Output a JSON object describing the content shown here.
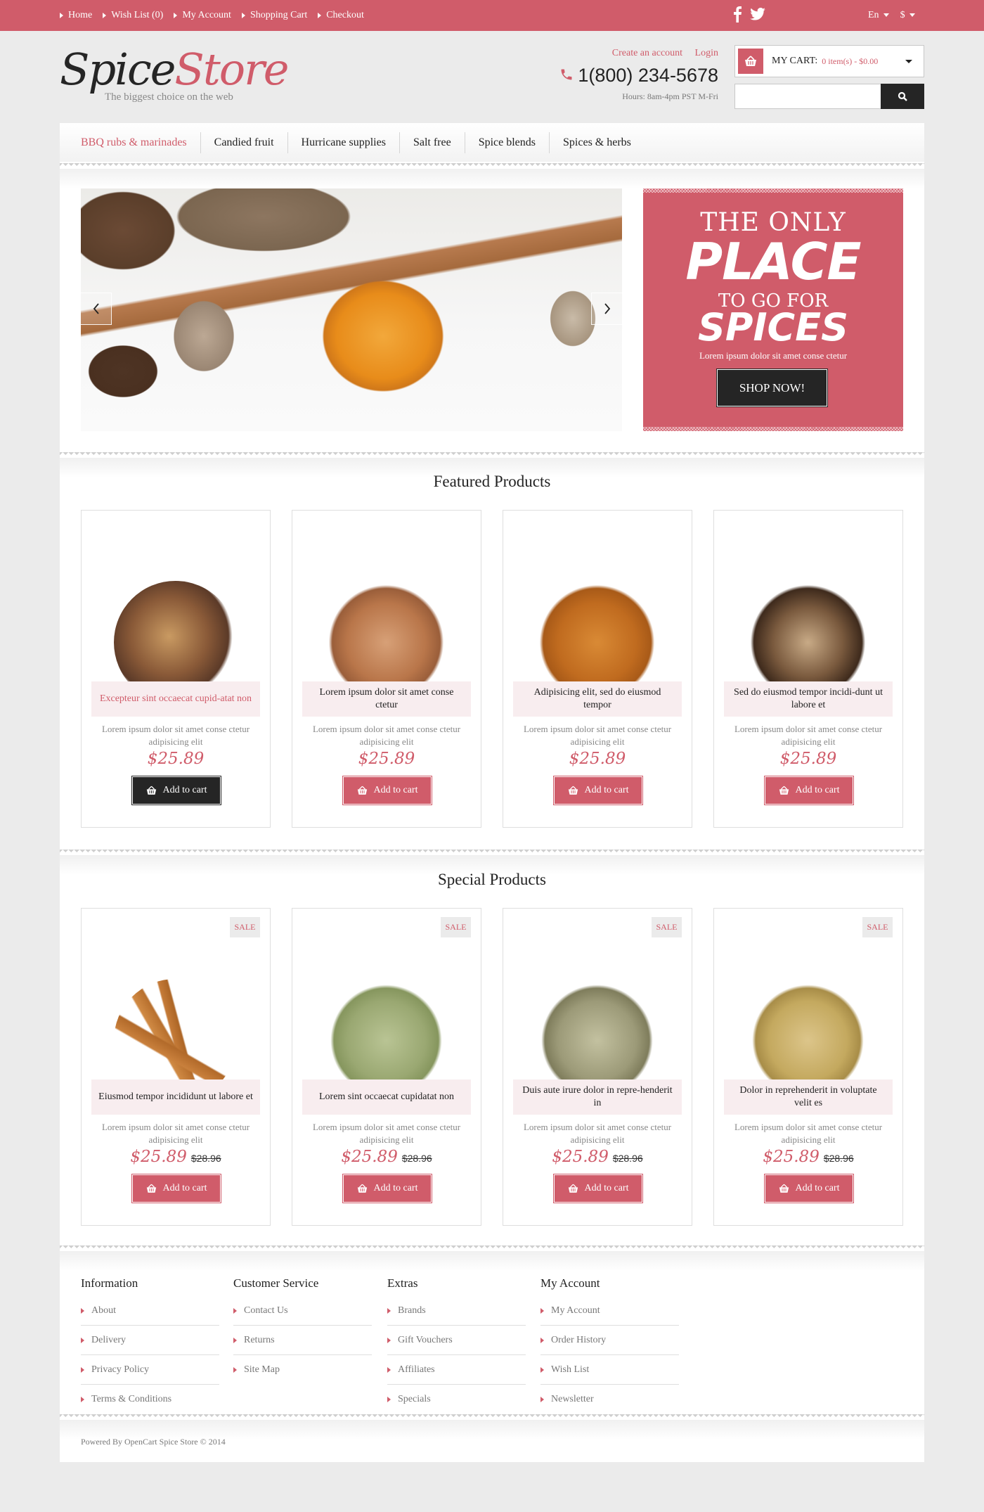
{
  "topbar": {
    "links": [
      "Home",
      "Wish List (0)",
      "My Account",
      "Shopping Cart",
      "Checkout"
    ],
    "social": [
      "facebook-icon",
      "twitter-icon"
    ],
    "language": "En",
    "currency": "$"
  },
  "header": {
    "logo_part1": "Spice",
    "logo_part2": "Store",
    "tagline": "The biggest choice on the web",
    "create_account": "Create an account",
    "login": "Login",
    "phone": "1(800) 234-5678",
    "hours": "Hours: 8am-4pm PST M-Fri",
    "cart_label": "MY CART:",
    "cart_value": "0 item(s) - $0.00",
    "search_placeholder": ""
  },
  "nav": {
    "items": [
      "BBQ rubs & marinades",
      "Candied fruit",
      "Hurricane supplies",
      "Salt free",
      "Spice blends",
      "Spices & herbs"
    ],
    "active_index": 0
  },
  "promo": {
    "line1": "THE ONLY",
    "line2": "PLACE",
    "line3": "TO GO FOR",
    "line4": "SPICES",
    "subtitle": "Lorem ipsum dolor sit amet conse ctetur",
    "button": "SHOP NOW!"
  },
  "featured": {
    "title": "Featured Products",
    "products": [
      {
        "name": "Excepteur sint occaecat cupid-atat non",
        "desc": "Lorem ipsum dolor sit amet conse ctetur adipisicing elit",
        "price": "$25.89",
        "button": "Add to cart",
        "highlight": true
      },
      {
        "name": "Lorem ipsum dolor sit amet conse ctetur",
        "desc": "Lorem ipsum dolor sit amet conse ctetur adipisicing elit",
        "price": "$25.89",
        "button": "Add to cart"
      },
      {
        "name": "Adipisicing elit, sed do eiusmod tempor",
        "desc": "Lorem ipsum dolor sit amet conse ctetur adipisicing elit",
        "price": "$25.89",
        "button": "Add to cart"
      },
      {
        "name": "Sed do eiusmod tempor incidi-dunt ut labore et",
        "desc": "Lorem ipsum dolor sit amet conse ctetur adipisicing elit",
        "price": "$25.89",
        "button": "Add to cart"
      }
    ]
  },
  "special": {
    "title": "Special Products",
    "products": [
      {
        "badge": "SALE",
        "name": "Eiusmod tempor incididunt ut labore et",
        "desc": "Lorem ipsum dolor sit amet conse ctetur adipisicing elit",
        "price": "$25.89",
        "old_price": "$28.96",
        "button": "Add to cart"
      },
      {
        "badge": "SALE",
        "name": "Lorem sint occaecat cupidatat non",
        "desc": "Lorem ipsum dolor sit amet conse ctetur adipisicing elit",
        "price": "$25.89",
        "old_price": "$28.96",
        "button": "Add to cart"
      },
      {
        "badge": "SALE",
        "name": "Duis aute irure dolor in repre-henderit in",
        "desc": "Lorem ipsum dolor sit amet conse ctetur adipisicing elit",
        "price": "$25.89",
        "old_price": "$28.96",
        "button": "Add to cart"
      },
      {
        "badge": "SALE",
        "name": "Dolor in reprehenderit in voluptate velit es",
        "desc": "Lorem ipsum dolor sit amet conse ctetur adipisicing elit",
        "price": "$25.89",
        "old_price": "$28.96",
        "button": "Add to cart"
      }
    ]
  },
  "footer": {
    "columns": [
      {
        "title": "Information",
        "links": [
          "About",
          "Delivery",
          "Privacy Policy",
          "Terms & Conditions"
        ]
      },
      {
        "title": "Customer Service",
        "links": [
          "Contact Us",
          "Returns",
          "Site Map"
        ]
      },
      {
        "title": "Extras",
        "links": [
          "Brands",
          "Gift Vouchers",
          "Affiliates",
          "Specials"
        ]
      },
      {
        "title": "My Account",
        "links": [
          "My Account",
          "Order History",
          "Wish List",
          "Newsletter"
        ]
      }
    ],
    "copyright": "Powered By OpenCart Spice Store © 2014"
  },
  "colors": {
    "accent": "#d05c6a",
    "dark": "#252525",
    "background": "#ebebeb",
    "name_bg": "#f8edef"
  }
}
